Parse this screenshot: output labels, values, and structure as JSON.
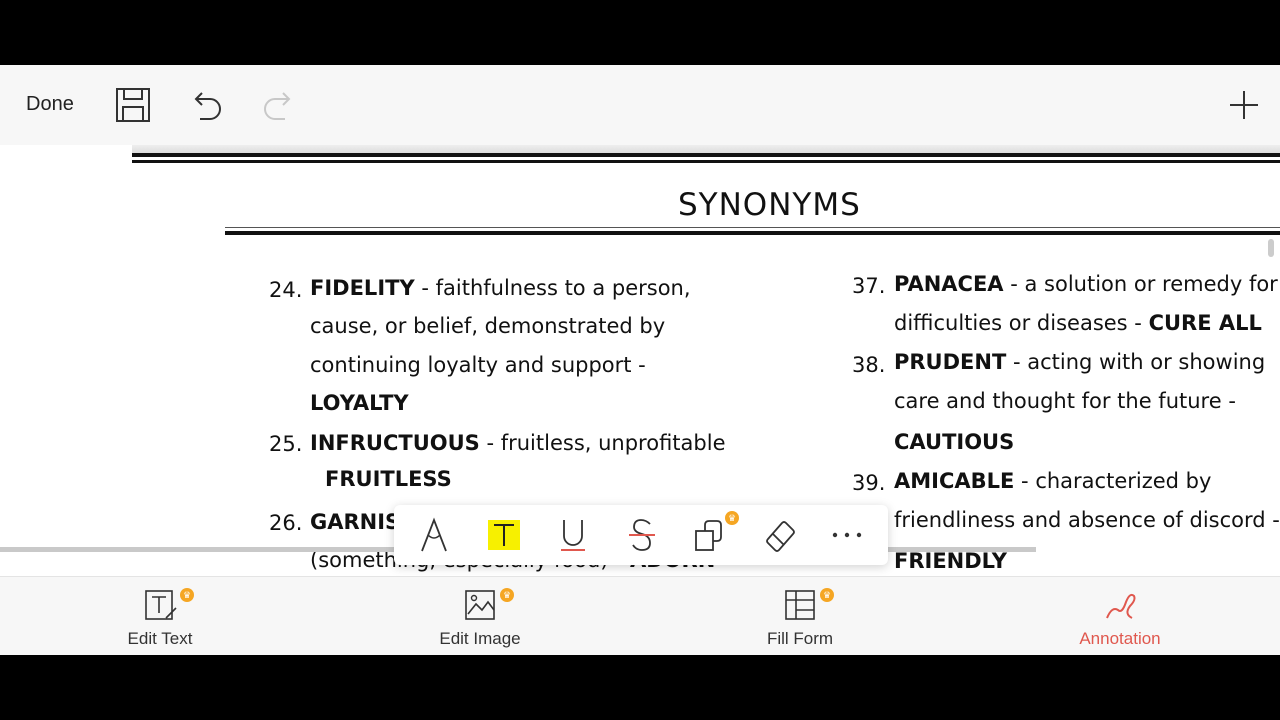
{
  "toolbar": {
    "done_label": "Done",
    "save_icon": "save-icon",
    "undo_icon": "undo-icon",
    "redo_icon": "redo-icon",
    "add_icon": "plus-icon"
  },
  "document": {
    "heading": "SYNONYMS",
    "left_column": [
      {
        "num": "24.",
        "term": "FIDELITY",
        "lines": [
          "faithfulness to a person,",
          "cause, or belief, demonstrated by",
          "continuing loyalty and support -"
        ],
        "answer": "LOYALTY"
      },
      {
        "num": "25.",
        "term": "INFRUCTUOUS",
        "lines": [
          "fruitless, unprofitable"
        ],
        "answer": "FRUITLESS"
      },
      {
        "num": "26.",
        "term": "GARNIS",
        "lines": [
          "(something, especially food)"
        ],
        "answer": "ADORN"
      }
    ],
    "right_column": [
      {
        "num": "37.",
        "term": "PANACEA",
        "lines": [
          "a solution or remedy for",
          "difficulties or diseases -"
        ],
        "answer": "CURE ALL"
      },
      {
        "num": "38.",
        "term": "PRUDENT",
        "lines": [
          "acting with or showing",
          "care and thought for the future -"
        ],
        "answer": "CAUTIOUS"
      },
      {
        "num": "39.",
        "term": "AMICABLE",
        "lines": [
          "characterized by",
          "friendliness and absence of discord -"
        ],
        "answer": "FRIENDLY"
      }
    ]
  },
  "annotation_tools": [
    {
      "name": "pen-tool-icon",
      "label": "A"
    },
    {
      "name": "highlight-text-icon",
      "label": "T"
    },
    {
      "name": "underline-icon",
      "label": "U"
    },
    {
      "name": "strikethrough-icon",
      "label": "S"
    },
    {
      "name": "shapes-icon"
    },
    {
      "name": "eraser-icon"
    },
    {
      "name": "more-icon",
      "label": "···"
    }
  ],
  "tabs": [
    {
      "label": "Edit Text",
      "icon": "edit-text-icon",
      "premium": true
    },
    {
      "label": "Edit Image",
      "icon": "edit-image-icon",
      "premium": true
    },
    {
      "label": "Fill Form",
      "icon": "fill-form-icon",
      "premium": true
    },
    {
      "label": "Annotation",
      "icon": "annotation-icon",
      "active": true
    }
  ],
  "colors": {
    "accent": "#e0584e",
    "highlight": "#f7f000",
    "premium_badge": "#f5a623"
  }
}
